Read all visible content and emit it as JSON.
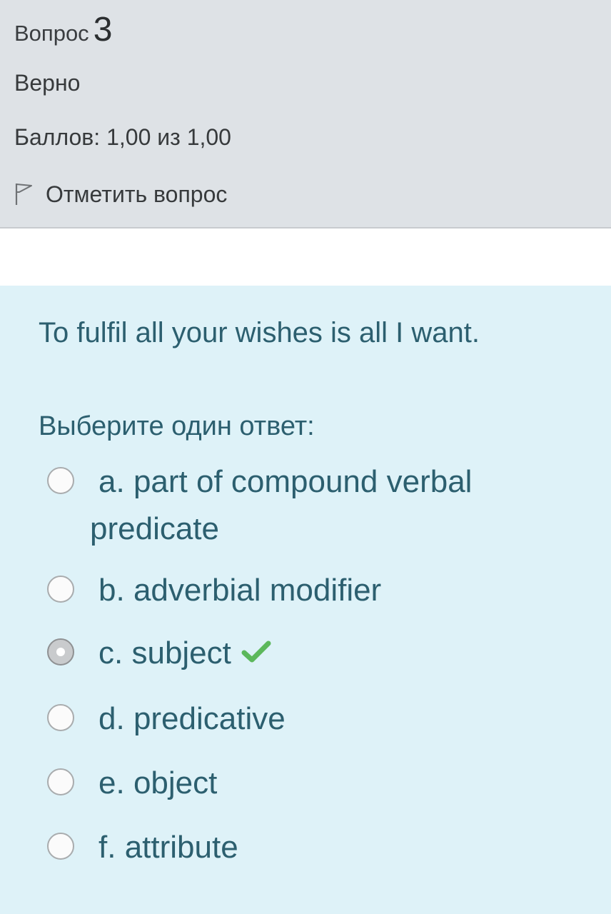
{
  "info": {
    "question_label": "Вопрос",
    "question_number": "3",
    "state": "Верно",
    "grade": "Баллов: 1,00 из 1,00",
    "flag_label": "Отметить вопрос"
  },
  "question": {
    "text": "To fulfil all your wishes is all I want.",
    "prompt": "Выберите один ответ:",
    "options": [
      {
        "letter": "a.",
        "label": "part of compound verbal",
        "label_cont": "predicate",
        "checked": false
      },
      {
        "letter": "b.",
        "label": "adverbial modifier",
        "checked": false
      },
      {
        "letter": "c.",
        "label": "subject",
        "checked": true,
        "correct": true
      },
      {
        "letter": "d.",
        "label": "predicative",
        "checked": false
      },
      {
        "letter": "e.",
        "label": "object",
        "checked": false
      },
      {
        "letter": "f.",
        "label": "attribute",
        "checked": false
      }
    ]
  },
  "icons": {
    "flag": "flag-icon",
    "correct": "checkmark-icon"
  },
  "colors": {
    "info_bg": "#dee2e6",
    "content_bg": "#def2f8",
    "content_text": "#2c5f6f",
    "correct_green": "#5cb85c"
  }
}
